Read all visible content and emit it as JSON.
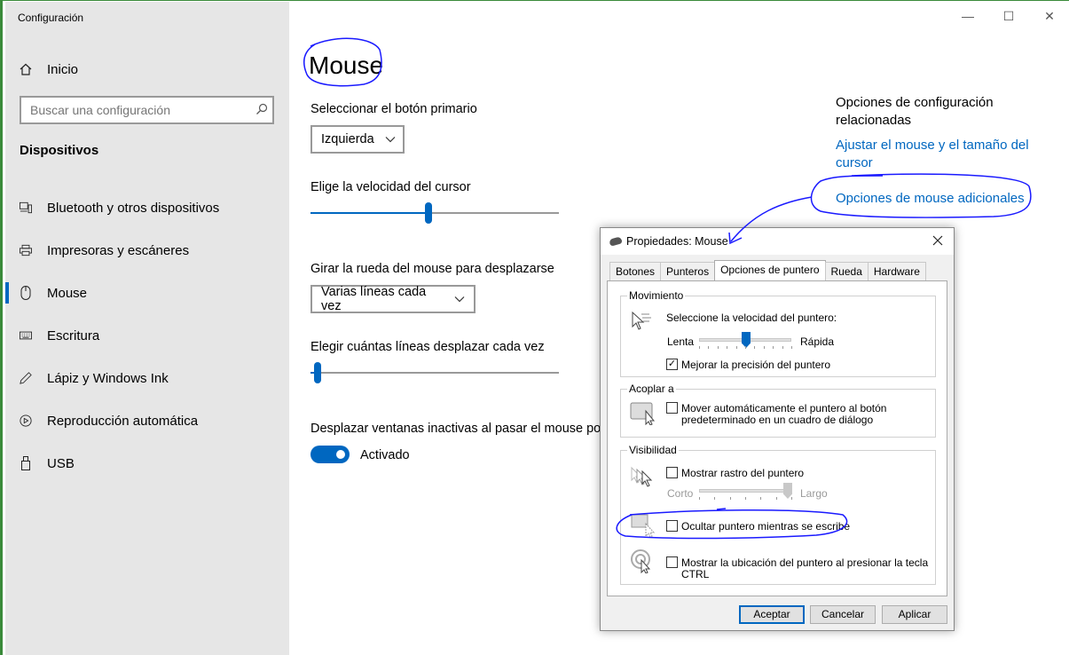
{
  "window": {
    "title": "Configuración",
    "minimize": "—",
    "maximize": "☐",
    "close": "✕"
  },
  "sidebar": {
    "home_label": "Inicio",
    "search_placeholder": "Buscar una configuración",
    "section_title": "Dispositivos",
    "items": [
      {
        "label": "Bluetooth y otros dispositivos",
        "icon": "bluetooth-devices-icon"
      },
      {
        "label": "Impresoras y escáneres",
        "icon": "printer-icon"
      },
      {
        "label": "Mouse",
        "icon": "mouse-icon"
      },
      {
        "label": "Escritura",
        "icon": "keyboard-icon"
      },
      {
        "label": "Lápiz y Windows Ink",
        "icon": "pen-icon"
      },
      {
        "label": "Reproducción automática",
        "icon": "autoplay-icon"
      },
      {
        "label": "USB",
        "icon": "usb-icon"
      }
    ],
    "active_item": "Mouse"
  },
  "main": {
    "title": "Mouse",
    "primary_button_label": "Seleccionar el botón primario",
    "primary_button_value": "Izquierda",
    "cursor_speed_label": "Elige la velocidad del cursor",
    "cursor_speed_level": 0.475,
    "wheel_label": "Girar la rueda del mouse para desplazarse",
    "wheel_value": "Varias líneas cada vez",
    "lines_label": "Elegir cuántas líneas desplazar cada vez",
    "lines_level": 0.03,
    "inactive_scroll_label": "Desplazar ventanas inactivas al pasar el mouse po",
    "inactive_scroll_state": "Activado",
    "related_title": "Opciones de configuración relacionadas",
    "related_link_1": "Ajustar el mouse y el tamaño del cursor",
    "related_link_2": "Opciones de mouse adicionales"
  },
  "dialog": {
    "title": "Propiedades: Mouse",
    "tabs": [
      "Botones",
      "Punteros",
      "Opciones de puntero",
      "Rueda",
      "Hardware"
    ],
    "active_tab": "Opciones de puntero",
    "movement": {
      "group": "Movimiento",
      "speed_label": "Seleccione la velocidad del puntero:",
      "slow": "Lenta",
      "fast": "Rápida",
      "speed_level": 0.5,
      "precision_label": "Mejorar la precisión del puntero",
      "precision_checked": true
    },
    "snap": {
      "group": "Acoplar a",
      "label_line1": "Mover automáticamente el puntero al botón",
      "label_line2": "predeterminado en un cuadro de diálogo",
      "checked": false
    },
    "visibility": {
      "group": "Visibilidad",
      "trail_label": "Mostrar rastro del puntero",
      "trail_checked": false,
      "short": "Corto",
      "long": "Largo",
      "trail_level": 0.95,
      "hide_label": "Ocultar puntero mientras se escribe",
      "hide_checked": false,
      "ctrl_label": "Mostrar la ubicación del puntero al presionar la tecla CTRL",
      "ctrl_checked": false
    },
    "buttons": {
      "ok": "Aceptar",
      "cancel": "Cancelar",
      "apply": "Aplicar"
    }
  },
  "colors": {
    "accent": "#0067c0",
    "sidebar_bg": "#e6e6e6",
    "annotation_ink": "#1a1aff"
  }
}
